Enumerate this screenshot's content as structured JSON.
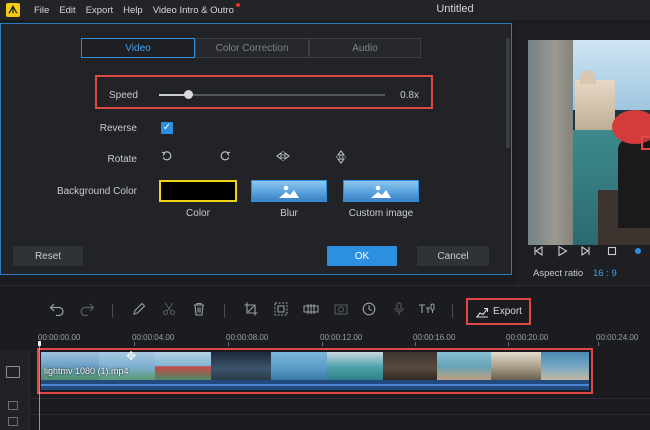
{
  "menubar": {
    "logo": "ᗑ",
    "items": [
      "File",
      "Edit",
      "Export",
      "Help",
      "Video Intro & Outro"
    ],
    "title": "Untitled"
  },
  "dialog": {
    "tabs": [
      "Video",
      "Color Correction",
      "Audio"
    ],
    "active_tab": "Video",
    "speed": {
      "label": "Speed",
      "value": "0.8x",
      "slider_fraction": 0.13
    },
    "reverse": {
      "label": "Reverse",
      "checked": true,
      "check_glyph": "✓"
    },
    "rotate": {
      "label": "Rotate",
      "icons": [
        "rotate-left-icon",
        "rotate-right-icon",
        "flip-horizontal-icon",
        "flip-vertical-icon"
      ]
    },
    "background": {
      "label": "Background Color",
      "options": [
        "Color",
        "Blur",
        "Custom image"
      ],
      "selected": "Color",
      "color_swatch": "#000000"
    },
    "buttons": {
      "reset": "Reset",
      "ok": "OK",
      "cancel": "Cancel"
    }
  },
  "preview": {
    "aspect_label": "Aspect ratio",
    "aspect_value": "16 : 9"
  },
  "toolbar": {
    "export_label": "Export"
  },
  "timeline": {
    "ticks": [
      "00:00:00.00",
      "00:00:04.00",
      "00:00:08.00",
      "00:00:12.00",
      "00:00:16.00",
      "00:00:20.00",
      "00:00:24.00"
    ],
    "clip_name": "lightmv 1080 (1).mp4"
  },
  "colors": {
    "accent": "#2d8fe0",
    "highlight": "#e04848",
    "selected_swatch_border": "#f0d21a"
  }
}
